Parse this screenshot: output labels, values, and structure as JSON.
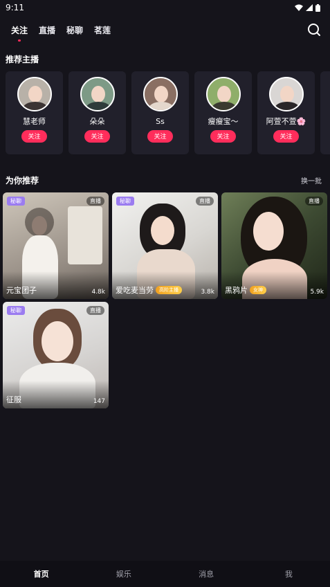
{
  "status": {
    "time": "9:11"
  },
  "top_tabs": [
    {
      "label": "关注"
    },
    {
      "label": "直播"
    },
    {
      "label": "秘聊"
    },
    {
      "label": "茗莲"
    }
  ],
  "sections": {
    "recommended_anchors": "推荐主播",
    "for_you": "为你推荐",
    "refresh": "换一批"
  },
  "anchors": [
    {
      "name": "慧老师",
      "follow": "关注"
    },
    {
      "name": "朵朵",
      "follow": "关注"
    },
    {
      "name": "Ss",
      "follow": "关注"
    },
    {
      "name": "瘦瘦宝～",
      "follow": "关注"
    },
    {
      "name": "阿萱不萱🌸",
      "follow": "关注"
    }
  ],
  "streams": [
    {
      "tag": "秘聊",
      "live": "直播",
      "name": "元宝团子",
      "count": "4.8k",
      "level": ""
    },
    {
      "tag": "秘聊",
      "live": "直播",
      "name": "爱吃麦当劳",
      "count": "3.8k",
      "level": "高阶主播"
    },
    {
      "tag": "",
      "live": "直播",
      "name": "黑鸦片",
      "count": "5.9k",
      "level": "女神"
    },
    {
      "tag": "秘聊",
      "live": "直播",
      "name": "征服",
      "count": "147",
      "level": ""
    }
  ],
  "bottom_nav": [
    {
      "label": "首页"
    },
    {
      "label": "娱乐"
    },
    {
      "label": "消息"
    },
    {
      "label": "我"
    }
  ],
  "colors": {
    "accent": "#ff2d5b",
    "background": "#15141b",
    "card": "#21202b",
    "tag": "#9b7cf0"
  }
}
